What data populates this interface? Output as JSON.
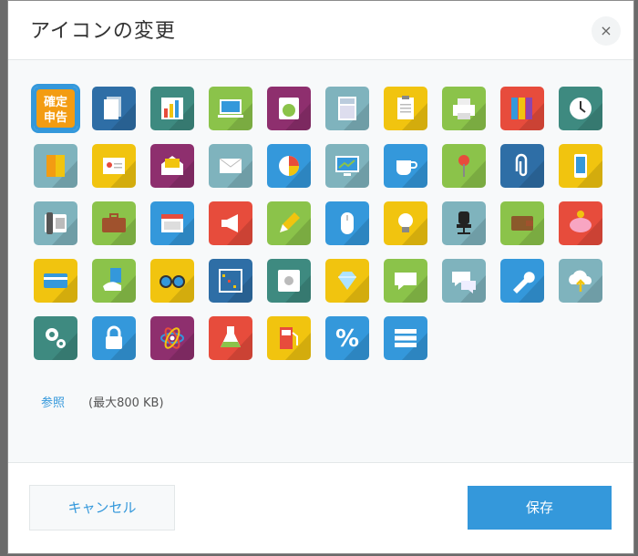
{
  "dialog": {
    "title": "アイコンの変更",
    "close_label": "×",
    "browse_label": "参照",
    "size_note": "(最大800 KB)",
    "cancel_label": "キャンセル",
    "save_label": "保存"
  },
  "icons": [
    {
      "name": "tax-return-icon",
      "bg": "#3498db",
      "selected": true,
      "label_top": "確定",
      "label_bottom": "申告"
    },
    {
      "name": "documents-icon",
      "bg": "#2e6ea6"
    },
    {
      "name": "bar-chart-icon",
      "bg": "#3e8a80"
    },
    {
      "name": "laptop-icon",
      "bg": "#8bc34a"
    },
    {
      "name": "hand-stamp-icon",
      "bg": "#8e2f6e"
    },
    {
      "name": "calculator-icon",
      "bg": "#7fb3bd"
    },
    {
      "name": "clipboard-icon",
      "bg": "#f1c40f"
    },
    {
      "name": "printer-icon",
      "bg": "#8bc34a"
    },
    {
      "name": "binders-icon",
      "bg": "#e74c3c"
    },
    {
      "name": "clock-icon",
      "bg": "#3e8a80"
    },
    {
      "name": "door-icon",
      "bg": "#7fb3bd"
    },
    {
      "name": "id-card-icon",
      "bg": "#f1c40f"
    },
    {
      "name": "open-envelope-icon",
      "bg": "#8e2f6e"
    },
    {
      "name": "envelope-icon",
      "bg": "#7fb3bd"
    },
    {
      "name": "pie-chart-icon",
      "bg": "#3498db"
    },
    {
      "name": "monitor-chart-icon",
      "bg": "#7fb3bd"
    },
    {
      "name": "coffee-cup-icon",
      "bg": "#3498db"
    },
    {
      "name": "pushpin-icon",
      "bg": "#8bc34a"
    },
    {
      "name": "paperclip-icon",
      "bg": "#2e6ea6"
    },
    {
      "name": "smartphone-icon",
      "bg": "#f1c40f"
    },
    {
      "name": "telephone-icon",
      "bg": "#7fb3bd"
    },
    {
      "name": "briefcase-icon",
      "bg": "#8bc34a"
    },
    {
      "name": "calendar-icon",
      "bg": "#3498db"
    },
    {
      "name": "megaphone-icon",
      "bg": "#e74c3c"
    },
    {
      "name": "pencil-icon",
      "bg": "#8bc34a"
    },
    {
      "name": "mouse-icon",
      "bg": "#3498db"
    },
    {
      "name": "light-bulb-icon",
      "bg": "#f1c40f"
    },
    {
      "name": "office-chair-icon",
      "bg": "#7fb3bd"
    },
    {
      "name": "wallet-icon",
      "bg": "#8bc34a"
    },
    {
      "name": "piggy-bank-icon",
      "bg": "#e74c3c"
    },
    {
      "name": "credit-card-icon",
      "bg": "#f1c40f"
    },
    {
      "name": "hand-card-icon",
      "bg": "#8bc34a"
    },
    {
      "name": "glasses-icon",
      "bg": "#f1c40f"
    },
    {
      "name": "abacus-icon",
      "bg": "#2e6ea6"
    },
    {
      "name": "safe-icon",
      "bg": "#3e8a80"
    },
    {
      "name": "diamond-icon",
      "bg": "#f1c40f"
    },
    {
      "name": "speech-bubble-icon",
      "bg": "#8bc34a"
    },
    {
      "name": "chat-bubbles-icon",
      "bg": "#7fb3bd"
    },
    {
      "name": "wrench-icon",
      "bg": "#3498db"
    },
    {
      "name": "cloud-upload-icon",
      "bg": "#7fb3bd"
    },
    {
      "name": "gears-icon",
      "bg": "#3e8a80"
    },
    {
      "name": "padlock-icon",
      "bg": "#3498db"
    },
    {
      "name": "atom-icon",
      "bg": "#8e2f6e"
    },
    {
      "name": "flask-icon",
      "bg": "#e74c3c"
    },
    {
      "name": "fuel-pump-icon",
      "bg": "#f1c40f"
    },
    {
      "name": "percent-icon",
      "bg": "#3498db",
      "glyph": "%"
    },
    {
      "name": "list-icon",
      "bg": "#3498db"
    }
  ]
}
